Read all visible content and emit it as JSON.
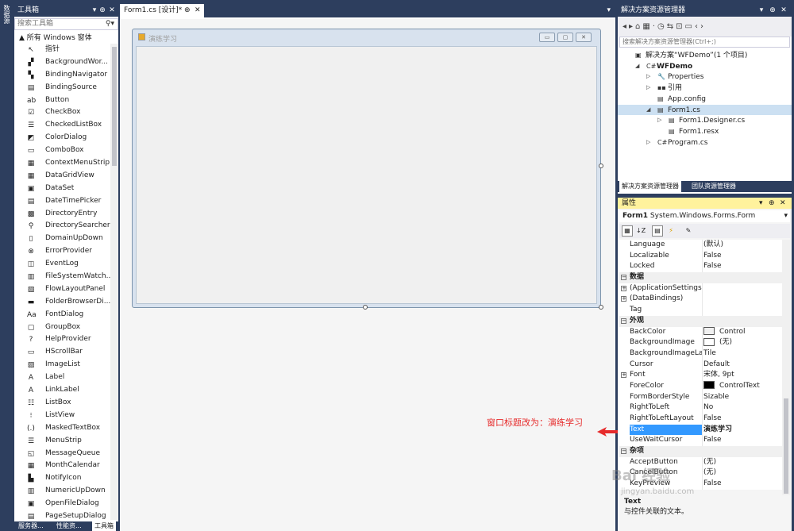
{
  "left_strip": {
    "label": "数据源"
  },
  "toolbox": {
    "title": "工具箱",
    "search_placeholder": "搜索工具箱",
    "group_label": "▲ 所有 Windows 窗体",
    "items": [
      {
        "label": "指针",
        "icon": "pointer-icon",
        "glyph": "↖"
      },
      {
        "label": "BackgroundWor...",
        "icon": "backgroundworker-icon",
        "glyph": "▞"
      },
      {
        "label": "BindingNavigator",
        "icon": "bindingnavigator-icon",
        "glyph": "▚"
      },
      {
        "label": "BindingSource",
        "icon": "bindingsource-icon",
        "glyph": "▤"
      },
      {
        "label": "Button",
        "icon": "button-icon",
        "glyph": "ab"
      },
      {
        "label": "CheckBox",
        "icon": "checkbox-icon",
        "glyph": "☑"
      },
      {
        "label": "CheckedListBox",
        "icon": "checkedlistbox-icon",
        "glyph": "☰"
      },
      {
        "label": "ColorDialog",
        "icon": "colordialog-icon",
        "glyph": "◩"
      },
      {
        "label": "ComboBox",
        "icon": "combobox-icon",
        "glyph": "▭"
      },
      {
        "label": "ContextMenuStrip",
        "icon": "contextmenustrip-icon",
        "glyph": "▦"
      },
      {
        "label": "DataGridView",
        "icon": "datagridview-icon",
        "glyph": "▦"
      },
      {
        "label": "DataSet",
        "icon": "dataset-icon",
        "glyph": "▣"
      },
      {
        "label": "DateTimePicker",
        "icon": "datetimepicker-icon",
        "glyph": "▤"
      },
      {
        "label": "DirectoryEntry",
        "icon": "directoryentry-icon",
        "glyph": "▩"
      },
      {
        "label": "DirectorySearcher",
        "icon": "directorysearcher-icon",
        "glyph": "⚲"
      },
      {
        "label": "DomainUpDown",
        "icon": "domainupdown-icon",
        "glyph": "▯"
      },
      {
        "label": "ErrorProvider",
        "icon": "errorprovider-icon",
        "glyph": "⊗"
      },
      {
        "label": "EventLog",
        "icon": "eventlog-icon",
        "glyph": "◫"
      },
      {
        "label": "FileSystemWatch...",
        "icon": "filesystemwatcher-icon",
        "glyph": "▥"
      },
      {
        "label": "FlowLayoutPanel",
        "icon": "flowlayoutpanel-icon",
        "glyph": "▧"
      },
      {
        "label": "FolderBrowserDi...",
        "icon": "folderbrowserdialog-icon",
        "glyph": "▬"
      },
      {
        "label": "FontDialog",
        "icon": "fontdialog-icon",
        "glyph": "Aa"
      },
      {
        "label": "GroupBox",
        "icon": "groupbox-icon",
        "glyph": "▢"
      },
      {
        "label": "HelpProvider",
        "icon": "helpprovider-icon",
        "glyph": "?"
      },
      {
        "label": "HScrollBar",
        "icon": "hscrollbar-icon",
        "glyph": "▭"
      },
      {
        "label": "ImageList",
        "icon": "imagelist-icon",
        "glyph": "▨"
      },
      {
        "label": "Label",
        "icon": "label-icon",
        "glyph": "A"
      },
      {
        "label": "LinkLabel",
        "icon": "linklabel-icon",
        "glyph": "A"
      },
      {
        "label": "ListBox",
        "icon": "listbox-icon",
        "glyph": "☷"
      },
      {
        "label": "ListView",
        "icon": "listview-icon",
        "glyph": "⁝"
      },
      {
        "label": "MaskedTextBox",
        "icon": "maskedtextbox-icon",
        "glyph": "(.)"
      },
      {
        "label": "MenuStrip",
        "icon": "menustrip-icon",
        "glyph": "☰"
      },
      {
        "label": "MessageQueue",
        "icon": "messagequeue-icon",
        "glyph": "◱"
      },
      {
        "label": "MonthCalendar",
        "icon": "monthcalendar-icon",
        "glyph": "▦"
      },
      {
        "label": "NotifyIcon",
        "icon": "notifyicon-icon",
        "glyph": "▙"
      },
      {
        "label": "NumericUpDown",
        "icon": "numericupdown-icon",
        "glyph": "▥"
      },
      {
        "label": "OpenFileDialog",
        "icon": "openfiledialog-icon",
        "glyph": "▣"
      },
      {
        "label": "PageSetupDialog",
        "icon": "pagesetupdialog-icon",
        "glyph": "▤"
      }
    ],
    "bottom_tabs": [
      "服务器...",
      "性能资...",
      "工具箱"
    ]
  },
  "document": {
    "tab_label": "Form1.cs [设计]*",
    "tab_pin": "⊕",
    "tab_close": "✕",
    "form_title": "演练学习"
  },
  "solution": {
    "title": "解决方案资源管理器",
    "toolbar_glyphs": "◂▸⌂▦·◷⇆⊡▭‹›",
    "search_placeholder": "搜索解决方案资源管理器(Ctrl+;)",
    "tree": [
      {
        "label": "解决方案“WFDemo”(1 个项目)",
        "icon": "solution-icon",
        "glyph": "▣",
        "arrow": "",
        "level": 0
      },
      {
        "label": "WFDemo",
        "icon": "csharp-project-icon",
        "glyph": "C#",
        "arrow": "◢",
        "level": 1,
        "bold": true
      },
      {
        "label": "Properties",
        "icon": "wrench-icon",
        "glyph": "🔧",
        "arrow": "▷",
        "level": 2
      },
      {
        "label": "引用",
        "icon": "references-icon",
        "glyph": "▪▪",
        "arrow": "▷",
        "level": 2
      },
      {
        "label": "App.config",
        "icon": "config-file-icon",
        "glyph": "▤",
        "arrow": "",
        "level": 2
      },
      {
        "label": "Form1.cs",
        "icon": "form-file-icon",
        "glyph": "▤",
        "arrow": "◢",
        "level": 2,
        "selected": true
      },
      {
        "label": "Form1.Designer.cs",
        "icon": "cs-file-icon",
        "glyph": "▤",
        "arrow": "▷",
        "level": 3
      },
      {
        "label": "Form1.resx",
        "icon": "resx-file-icon",
        "glyph": "▤",
        "arrow": "",
        "level": 3
      },
      {
        "label": "Program.cs",
        "icon": "csharp-file-icon",
        "glyph": "C#",
        "arrow": "▷",
        "level": 2
      }
    ],
    "tabs": [
      "解决方案资源管理器",
      "团队资源管理器"
    ]
  },
  "properties": {
    "title": "属性",
    "object_name": "Form1",
    "object_type": "System.Windows.Forms.Form",
    "rows": [
      {
        "name": "Language",
        "value": "(默认)"
      },
      {
        "name": "Localizable",
        "value": "False"
      },
      {
        "name": "Locked",
        "value": "False"
      },
      {
        "name": "数据",
        "category": true,
        "toggle": "⊟"
      },
      {
        "name": "(ApplicationSettings)",
        "value": "",
        "expand": "⊞"
      },
      {
        "name": "(DataBindings)",
        "value": "",
        "expand": "⊞"
      },
      {
        "name": "Tag",
        "value": ""
      },
      {
        "name": "外观",
        "category": true,
        "toggle": "⊟"
      },
      {
        "name": "BackColor",
        "value": "Control",
        "swatch": "#f0f0f0"
      },
      {
        "name": "BackgroundImage",
        "value": "(无)",
        "swatch": "#ffffff"
      },
      {
        "name": "BackgroundImageLayout",
        "value": "Tile"
      },
      {
        "name": "Cursor",
        "value": "Default"
      },
      {
        "name": "Font",
        "value": "宋体, 9pt",
        "expand": "⊞"
      },
      {
        "name": "ForeColor",
        "value": "ControlText",
        "swatch": "#000000"
      },
      {
        "name": "FormBorderStyle",
        "value": "Sizable"
      },
      {
        "name": "RightToLeft",
        "value": "No"
      },
      {
        "name": "RightToLeftLayout",
        "value": "False"
      },
      {
        "name": "Text",
        "value": "演练学习",
        "selected": true
      },
      {
        "name": "UseWaitCursor",
        "value": "False"
      },
      {
        "name": "杂项",
        "category": true,
        "toggle": "⊟"
      },
      {
        "name": "AcceptButton",
        "value": "(无)"
      },
      {
        "name": "CancelButton",
        "value": "(无)"
      },
      {
        "name": "KeyPreview",
        "value": "False"
      }
    ],
    "description_title": "Text",
    "description_text": "与控件关联的文本。"
  },
  "annotation": {
    "text": "窗口标题改为：演练学习",
    "color": "#e62b2b"
  },
  "watermark": {
    "text": "Bai 经验",
    "sub": "jingyan.baidu.com"
  }
}
